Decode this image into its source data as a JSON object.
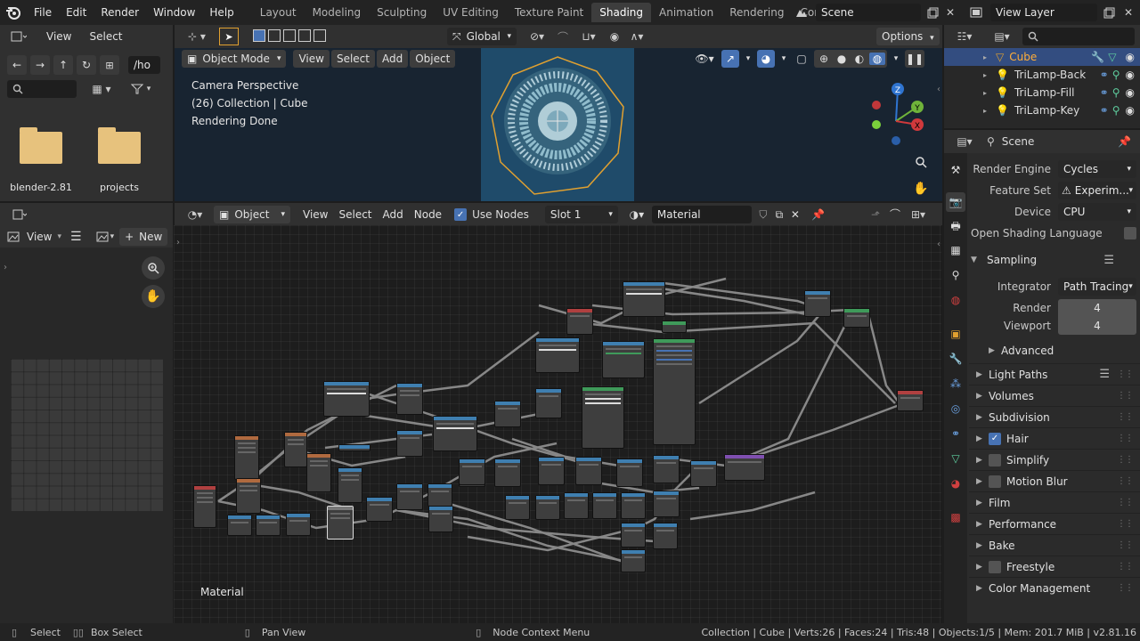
{
  "topbar": {
    "menus": [
      "File",
      "Edit",
      "Render",
      "Window",
      "Help"
    ],
    "workspaces": [
      "Layout",
      "Modeling",
      "Sculpting",
      "UV Editing",
      "Texture Paint",
      "Shading",
      "Animation",
      "Rendering",
      "Compos"
    ],
    "active_workspace": "Shading",
    "scene": "Scene",
    "view_layer": "View Layer"
  },
  "file_browser": {
    "header": {
      "view": "View",
      "select": "Select"
    },
    "path": "/ho",
    "items": [
      {
        "name": "blender-2.81"
      },
      {
        "name": "projects"
      }
    ]
  },
  "image_editor": {
    "view": "View",
    "new_label": "New"
  },
  "viewport": {
    "transform_orientation": "Global",
    "options": "Options",
    "mode": "Object Mode",
    "menus": [
      "View",
      "Select",
      "Add",
      "Object"
    ],
    "overlay_lines": [
      "Camera Perspective",
      "(26) Collection | Cube",
      "Rendering Done"
    ],
    "gizmo": {
      "x": "X",
      "y": "Y",
      "z": "Z"
    }
  },
  "node_editor": {
    "type": "Object",
    "menus": [
      "View",
      "Select",
      "Add",
      "Node"
    ],
    "use_nodes_label": "Use Nodes",
    "use_nodes": true,
    "slot": "Slot 1",
    "material": "Material",
    "corner_label": "Material"
  },
  "outliner": {
    "items": [
      {
        "name": "Cube",
        "selected": true
      },
      {
        "name": "TriLamp-Back",
        "selected": false
      },
      {
        "name": "TriLamp-Fill",
        "selected": false
      },
      {
        "name": "TriLamp-Key",
        "selected": false
      }
    ]
  },
  "properties": {
    "context": "Scene",
    "render_engine_label": "Render Engine",
    "render_engine": "Cycles",
    "feature_set_label": "Feature Set",
    "feature_set": "Experim...",
    "device_label": "Device",
    "device": "CPU",
    "osl_label": "Open Shading Language",
    "sampling": {
      "title": "Sampling",
      "integrator_label": "Integrator",
      "integrator": "Path Tracing",
      "render_label": "Render",
      "render": "4",
      "viewport_label": "Viewport",
      "viewport": "4",
      "advanced": "Advanced"
    },
    "sections": [
      {
        "label": "Light Paths",
        "checkbox": null
      },
      {
        "label": "Volumes",
        "checkbox": null
      },
      {
        "label": "Subdivision",
        "checkbox": null
      },
      {
        "label": "Hair",
        "checkbox": true
      },
      {
        "label": "Simplify",
        "checkbox": false
      },
      {
        "label": "Motion Blur",
        "checkbox": false
      },
      {
        "label": "Film",
        "checkbox": null
      },
      {
        "label": "Performance",
        "checkbox": null
      },
      {
        "label": "Bake",
        "checkbox": null
      },
      {
        "label": "Freestyle",
        "checkbox": false
      },
      {
        "label": "Color Management",
        "checkbox": null
      }
    ]
  },
  "statusbar": {
    "select": "Select",
    "box_select": "Box Select",
    "pan_view": "Pan View",
    "context_menu": "Node Context Menu",
    "stats": "Collection | Cube | Verts:26 | Faces:24 | Tris:48 | Objects:1/5 | Mem: 201.7 MiB | v2.81.16"
  },
  "colors": {
    "accent": "#4772b3",
    "selected_row": "#334d80",
    "folder": "#e7c27d",
    "node_header_blue": "#3f7fb0",
    "node_header_red": "#b04040",
    "node_header_orange": "#b06a3f",
    "node_header_green": "#3f9a5a"
  },
  "icons": [
    "blender-logo-icon",
    "folder-icon",
    "search-icon",
    "filter-icon",
    "zoom-icon",
    "hand-icon",
    "camera-icon",
    "light-icon",
    "eye-icon",
    "wrench-icon",
    "material-icon",
    "scene-icon",
    "render-icon",
    "pin-icon"
  ]
}
